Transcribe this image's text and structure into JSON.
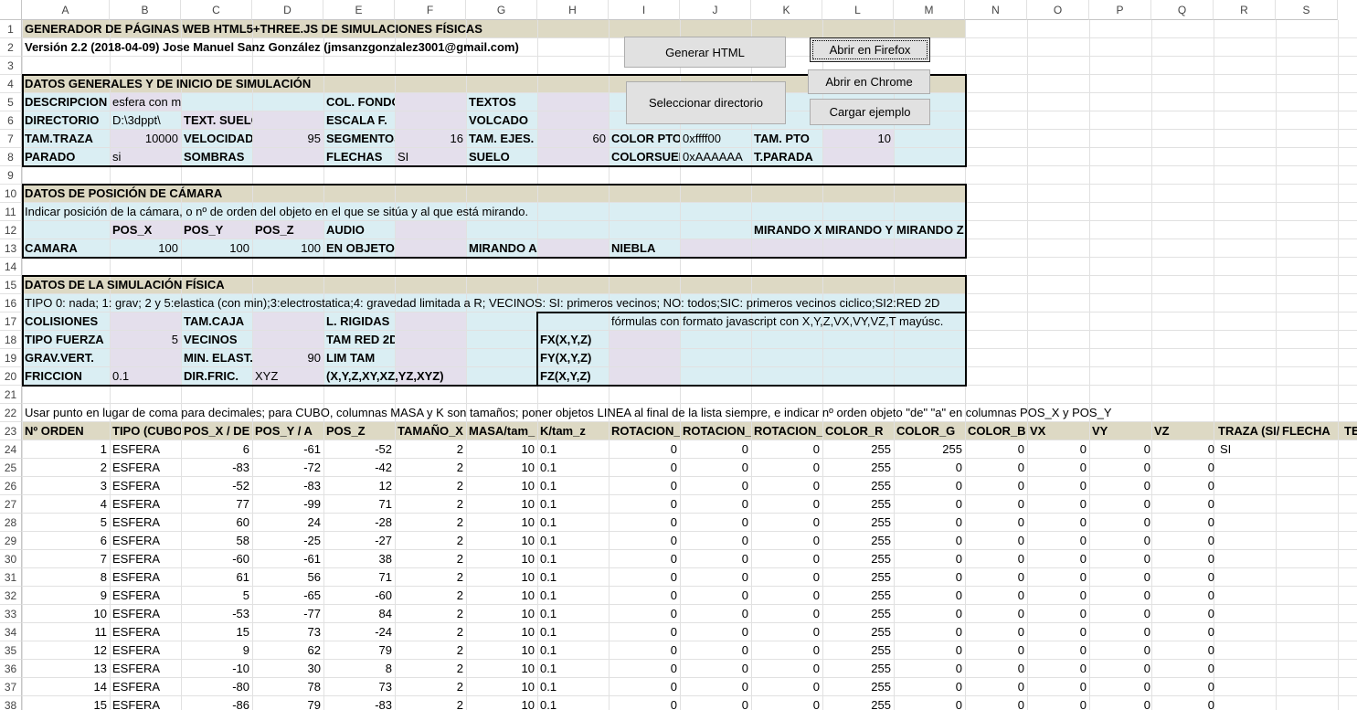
{
  "columns": [
    "A",
    "B",
    "C",
    "D",
    "E",
    "F",
    "G",
    "H",
    "I",
    "J",
    "K",
    "L",
    "M",
    "N",
    "O",
    "P",
    "Q",
    "R",
    "S"
  ],
  "row_numbers": [
    "1",
    "2",
    "3",
    "4",
    "5",
    "6",
    "7",
    "8",
    "9",
    "10",
    "11",
    "12",
    "13",
    "14",
    "15",
    "16",
    "17",
    "18",
    "19",
    "20",
    "21",
    "22",
    "23",
    "24",
    "25",
    "26",
    "27",
    "28",
    "29",
    "30",
    "31",
    "32",
    "33",
    "34",
    "35",
    "36",
    "37",
    "38"
  ],
  "buttons": {
    "generar": "Generar HTML",
    "firefox": "Abrir en Firefox",
    "chrome": "Abrir en Chrome",
    "directorio": "Seleccionar directorio",
    "ejemplo": "Cargar ejemplo"
  },
  "colors": {
    "header_band": "#ddd9c4",
    "light_blue": "#daeef3",
    "lavender": "#e4dfec",
    "border": "#000000"
  },
  "cells": [
    {
      "r": 1,
      "c": "A",
      "t": "GENERADOR DE PÁGINAS WEB HTML5+THREE.JS DE SIMULACIONES FÍSICAS",
      "b": 1
    },
    {
      "r": 2,
      "c": "A",
      "t": "Versión 2.2 (2018-04-09) Jose Manuel Sanz González (jmsanzgonzalez3001@gmail.com)",
      "b": 1
    },
    {
      "r": 4,
      "c": "A",
      "t": "DATOS GENERALES Y DE INICIO DE SIMULACIÓN",
      "b": 1
    },
    {
      "r": 5,
      "c": "A",
      "t": "DESCRIPCION",
      "b": 1
    },
    {
      "r": 5,
      "c": "B",
      "t": "esfera con minimo elastico"
    },
    {
      "r": 5,
      "c": "E",
      "t": "COL. FONDO",
      "b": 1
    },
    {
      "r": 5,
      "c": "G",
      "t": "TEXTOS",
      "b": 1
    },
    {
      "r": 6,
      "c": "A",
      "t": "DIRECTORIO",
      "b": 1
    },
    {
      "r": 6,
      "c": "B",
      "t": "D:\\3dppt\\"
    },
    {
      "r": 6,
      "c": "C",
      "t": "TEXT. SUELO",
      "b": 1
    },
    {
      "r": 6,
      "c": "E",
      "t": "ESCALA F.",
      "b": 1
    },
    {
      "r": 6,
      "c": "G",
      "t": "VOLCADO",
      "b": 1
    },
    {
      "r": 7,
      "c": "A",
      "t": "TAM.TRAZA",
      "b": 1
    },
    {
      "r": 7,
      "c": "B",
      "t": "10000",
      "n": 1
    },
    {
      "r": 7,
      "c": "C",
      "t": "VELOCIDAD",
      "b": 1
    },
    {
      "r": 7,
      "c": "D",
      "t": "95",
      "n": 1
    },
    {
      "r": 7,
      "c": "E",
      "t": "SEGMENTOS",
      "b": 1
    },
    {
      "r": 7,
      "c": "F",
      "t": "16",
      "n": 1
    },
    {
      "r": 7,
      "c": "G",
      "t": "TAM. EJES.",
      "b": 1
    },
    {
      "r": 7,
      "c": "H",
      "t": "60",
      "n": 1
    },
    {
      "r": 7,
      "c": "I",
      "t": "COLOR PTO",
      "b": 1
    },
    {
      "r": 7,
      "c": "J",
      "t": "0xffff00"
    },
    {
      "r": 7,
      "c": "K",
      "t": "TAM. PTO",
      "b": 1
    },
    {
      "r": 7,
      "c": "L",
      "t": "10",
      "n": 1
    },
    {
      "r": 8,
      "c": "A",
      "t": "PARADO",
      "b": 1
    },
    {
      "r": 8,
      "c": "B",
      "t": "si"
    },
    {
      "r": 8,
      "c": "C",
      "t": "SOMBRAS",
      "b": 1
    },
    {
      "r": 8,
      "c": "E",
      "t": "FLECHAS",
      "b": 1
    },
    {
      "r": 8,
      "c": "F",
      "t": "SI"
    },
    {
      "r": 8,
      "c": "G",
      "t": "SUELO",
      "b": 1
    },
    {
      "r": 8,
      "c": "I",
      "t": "COLORSUELO",
      "b": 1
    },
    {
      "r": 8,
      "c": "J",
      "t": "0xAAAAAA"
    },
    {
      "r": 8,
      "c": "K",
      "t": "T.PARADA",
      "b": 1
    },
    {
      "r": 10,
      "c": "A",
      "t": "DATOS DE POSICIÓN DE CÁMARA",
      "b": 1
    },
    {
      "r": 11,
      "c": "A",
      "t": "Indicar posición de la cámara, o nº de orden del objeto en el que se sitúa y al que está mirando."
    },
    {
      "r": 12,
      "c": "B",
      "t": "POS_X",
      "b": 1
    },
    {
      "r": 12,
      "c": "C",
      "t": "POS_Y",
      "b": 1
    },
    {
      "r": 12,
      "c": "D",
      "t": "POS_Z",
      "b": 1
    },
    {
      "r": 12,
      "c": "E",
      "t": "AUDIO",
      "b": 1
    },
    {
      "r": 12,
      "c": "K",
      "t": "MIRANDO X",
      "b": 1
    },
    {
      "r": 12,
      "c": "L",
      "t": "MIRANDO Y",
      "b": 1
    },
    {
      "r": 12,
      "c": "M",
      "t": "MIRANDO Z",
      "b": 1
    },
    {
      "r": 13,
      "c": "A",
      "t": "CAMARA",
      "b": 1
    },
    {
      "r": 13,
      "c": "B",
      "t": "100",
      "n": 1
    },
    {
      "r": 13,
      "c": "C",
      "t": "100",
      "n": 1
    },
    {
      "r": 13,
      "c": "D",
      "t": "100",
      "n": 1
    },
    {
      "r": 13,
      "c": "E",
      "t": "EN OBJETO",
      "b": 1
    },
    {
      "r": 13,
      "c": "G",
      "t": "MIRANDO A",
      "b": 1
    },
    {
      "r": 13,
      "c": "I",
      "t": "NIEBLA",
      "b": 1
    },
    {
      "r": 15,
      "c": "A",
      "t": "DATOS DE LA SIMULACIÓN FÍSICA",
      "b": 1
    },
    {
      "r": 16,
      "c": "A",
      "t": "TIPO 0: nada; 1: grav; 2 y 5:elastica (con min);3:electrostatica;4: gravedad limitada a R; VECINOS: SI: primeros vecinos; NO: todos;SIC: primeros vecinos ciclico;SI2:RED 2D"
    },
    {
      "r": 17,
      "c": "A",
      "t": "COLISIONES",
      "b": 1
    },
    {
      "r": 17,
      "c": "C",
      "t": "TAM.CAJA",
      "b": 1
    },
    {
      "r": 17,
      "c": "E",
      "t": "L. RIGIDAS",
      "b": 1
    },
    {
      "r": 17,
      "c": "I",
      "t": "fórmulas con formato javascript con X,Y,Z,VX,VY,VZ,T mayúsc."
    },
    {
      "r": 18,
      "c": "A",
      "t": "TIPO FUERZA",
      "b": 1
    },
    {
      "r": 18,
      "c": "B",
      "t": "5",
      "n": 1
    },
    {
      "r": 18,
      "c": "C",
      "t": "VECINOS",
      "b": 1
    },
    {
      "r": 18,
      "c": "E",
      "t": "TAM RED 2D",
      "b": 1
    },
    {
      "r": 18,
      "c": "H",
      "t": "FX(X,Y,Z)",
      "b": 1
    },
    {
      "r": 19,
      "c": "A",
      "t": "GRAV.VERT.",
      "b": 1
    },
    {
      "r": 19,
      "c": "C",
      "t": "MIN. ELAST.",
      "b": 1
    },
    {
      "r": 19,
      "c": "D",
      "t": "90",
      "n": 1
    },
    {
      "r": 19,
      "c": "E",
      "t": "LIM TAM",
      "b": 1
    },
    {
      "r": 19,
      "c": "H",
      "t": "FY(X,Y,Z)",
      "b": 1
    },
    {
      "r": 20,
      "c": "A",
      "t": "FRICCION",
      "b": 1
    },
    {
      "r": 20,
      "c": "B",
      "t": "0.1"
    },
    {
      "r": 20,
      "c": "C",
      "t": "DIR.FRIC.",
      "b": 1
    },
    {
      "r": 20,
      "c": "D",
      "t": "XYZ"
    },
    {
      "r": 20,
      "c": "E",
      "t": "(X,Y,Z,XY,XZ,YZ,XYZ)",
      "b": 1
    },
    {
      "r": 20,
      "c": "H",
      "t": "FZ(X,Y,Z)",
      "b": 1
    },
    {
      "r": 22,
      "c": "A",
      "t": "Usar punto en lugar de coma para decimales; para CUBO, columnas MASA y K son tamaños; poner objetos LINEA al final de la lista siempre, e indicar nº orden objeto \"de\" \"a\" en columnas POS_X y POS_Y"
    }
  ],
  "table_headers": [
    "Nº ORDEN",
    "TIPO (CUBO,",
    "POS_X / DE",
    "POS_Y / A",
    "POS_Z",
    "TAMAÑO_X",
    "MASA/tam_",
    "K/tam_z",
    "ROTACION_X",
    "ROTACION_Y",
    "ROTACION_Z",
    "COLOR_R",
    "COLOR_G",
    "COLOR_B",
    "VX",
    "VY",
    "VZ",
    "TRAZA (SI/",
    "FLECHA",
    "TE"
  ],
  "rows": [
    [
      "1",
      "ESFERA",
      "6",
      "-61",
      "-52",
      "2",
      "10",
      "0.1",
      "0",
      "0",
      "0",
      "255",
      "255",
      "0",
      "0",
      "0",
      "0",
      "SI"
    ],
    [
      "2",
      "ESFERA",
      "-83",
      "-72",
      "-42",
      "2",
      "10",
      "0.1",
      "0",
      "0",
      "0",
      "255",
      "0",
      "0",
      "0",
      "0",
      "0",
      ""
    ],
    [
      "3",
      "ESFERA",
      "-52",
      "-83",
      "12",
      "2",
      "10",
      "0.1",
      "0",
      "0",
      "0",
      "255",
      "0",
      "0",
      "0",
      "0",
      "0",
      ""
    ],
    [
      "4",
      "ESFERA",
      "77",
      "-99",
      "71",
      "2",
      "10",
      "0.1",
      "0",
      "0",
      "0",
      "255",
      "0",
      "0",
      "0",
      "0",
      "0",
      ""
    ],
    [
      "5",
      "ESFERA",
      "60",
      "24",
      "-28",
      "2",
      "10",
      "0.1",
      "0",
      "0",
      "0",
      "255",
      "0",
      "0",
      "0",
      "0",
      "0",
      ""
    ],
    [
      "6",
      "ESFERA",
      "58",
      "-25",
      "-27",
      "2",
      "10",
      "0.1",
      "0",
      "0",
      "0",
      "255",
      "0",
      "0",
      "0",
      "0",
      "0",
      ""
    ],
    [
      "7",
      "ESFERA",
      "-60",
      "-61",
      "38",
      "2",
      "10",
      "0.1",
      "0",
      "0",
      "0",
      "255",
      "0",
      "0",
      "0",
      "0",
      "0",
      ""
    ],
    [
      "8",
      "ESFERA",
      "61",
      "56",
      "71",
      "2",
      "10",
      "0.1",
      "0",
      "0",
      "0",
      "255",
      "0",
      "0",
      "0",
      "0",
      "0",
      ""
    ],
    [
      "9",
      "ESFERA",
      "5",
      "-65",
      "-60",
      "2",
      "10",
      "0.1",
      "0",
      "0",
      "0",
      "255",
      "0",
      "0",
      "0",
      "0",
      "0",
      ""
    ],
    [
      "10",
      "ESFERA",
      "-53",
      "-77",
      "84",
      "2",
      "10",
      "0.1",
      "0",
      "0",
      "0",
      "255",
      "0",
      "0",
      "0",
      "0",
      "0",
      ""
    ],
    [
      "11",
      "ESFERA",
      "15",
      "73",
      "-24",
      "2",
      "10",
      "0.1",
      "0",
      "0",
      "0",
      "255",
      "0",
      "0",
      "0",
      "0",
      "0",
      ""
    ],
    [
      "12",
      "ESFERA",
      "9",
      "62",
      "79",
      "2",
      "10",
      "0.1",
      "0",
      "0",
      "0",
      "255",
      "0",
      "0",
      "0",
      "0",
      "0",
      ""
    ],
    [
      "13",
      "ESFERA",
      "-10",
      "30",
      "8",
      "2",
      "10",
      "0.1",
      "0",
      "0",
      "0",
      "255",
      "0",
      "0",
      "0",
      "0",
      "0",
      ""
    ],
    [
      "14",
      "ESFERA",
      "-80",
      "78",
      "73",
      "2",
      "10",
      "0.1",
      "0",
      "0",
      "0",
      "255",
      "0",
      "0",
      "0",
      "0",
      "0",
      ""
    ],
    [
      "15",
      "ESFERA",
      "-86",
      "79",
      "-83",
      "2",
      "10",
      "0.1",
      "0",
      "0",
      "0",
      "255",
      "0",
      "0",
      "0",
      "0",
      "0",
      ""
    ]
  ]
}
